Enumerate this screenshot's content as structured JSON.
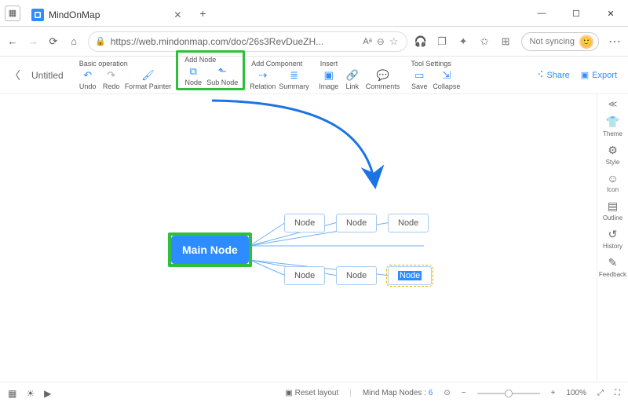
{
  "browser": {
    "tab_title": "MindOnMap",
    "url": "https://web.mindonmap.com/doc/26s3RevDueZH...",
    "sync_label": "Not syncing",
    "aa_label": "Aᵃ"
  },
  "app": {
    "doc_title": "Untitled",
    "share": "Share",
    "export": "Export"
  },
  "toolbar": {
    "groups": {
      "basic": {
        "title": "Basic operation",
        "undo": "Undo",
        "redo": "Redo",
        "format_painter": "Format Painter"
      },
      "add_node": {
        "title": "Add Node",
        "node": "Node",
        "sub_node": "Sub Node"
      },
      "add_component": {
        "title": "Add Component",
        "relation": "Relation",
        "summary": "Summary"
      },
      "insert": {
        "title": "Insert",
        "image": "Image",
        "link": "Link",
        "comments": "Comments"
      },
      "tool_settings": {
        "title": "Tool Settings",
        "save": "Save",
        "collapse": "Collapse"
      }
    }
  },
  "sidepanel": {
    "theme": "Theme",
    "style": "Style",
    "icon": "Icon",
    "outline": "Outline",
    "history": "History",
    "feedback": "Feedback"
  },
  "mindmap": {
    "main": "Main Node",
    "children": {
      "r1c1": "Node",
      "r1c2": "Node",
      "r1c3": "Node",
      "r2c1": "Node",
      "r2c2": "Node",
      "r2c3": "Node"
    }
  },
  "status": {
    "reset": "Reset layout",
    "nodes_label": "Mind Map Nodes",
    "nodes_count": "6",
    "zoom": "100%",
    "minus": "−",
    "plus": "+"
  }
}
